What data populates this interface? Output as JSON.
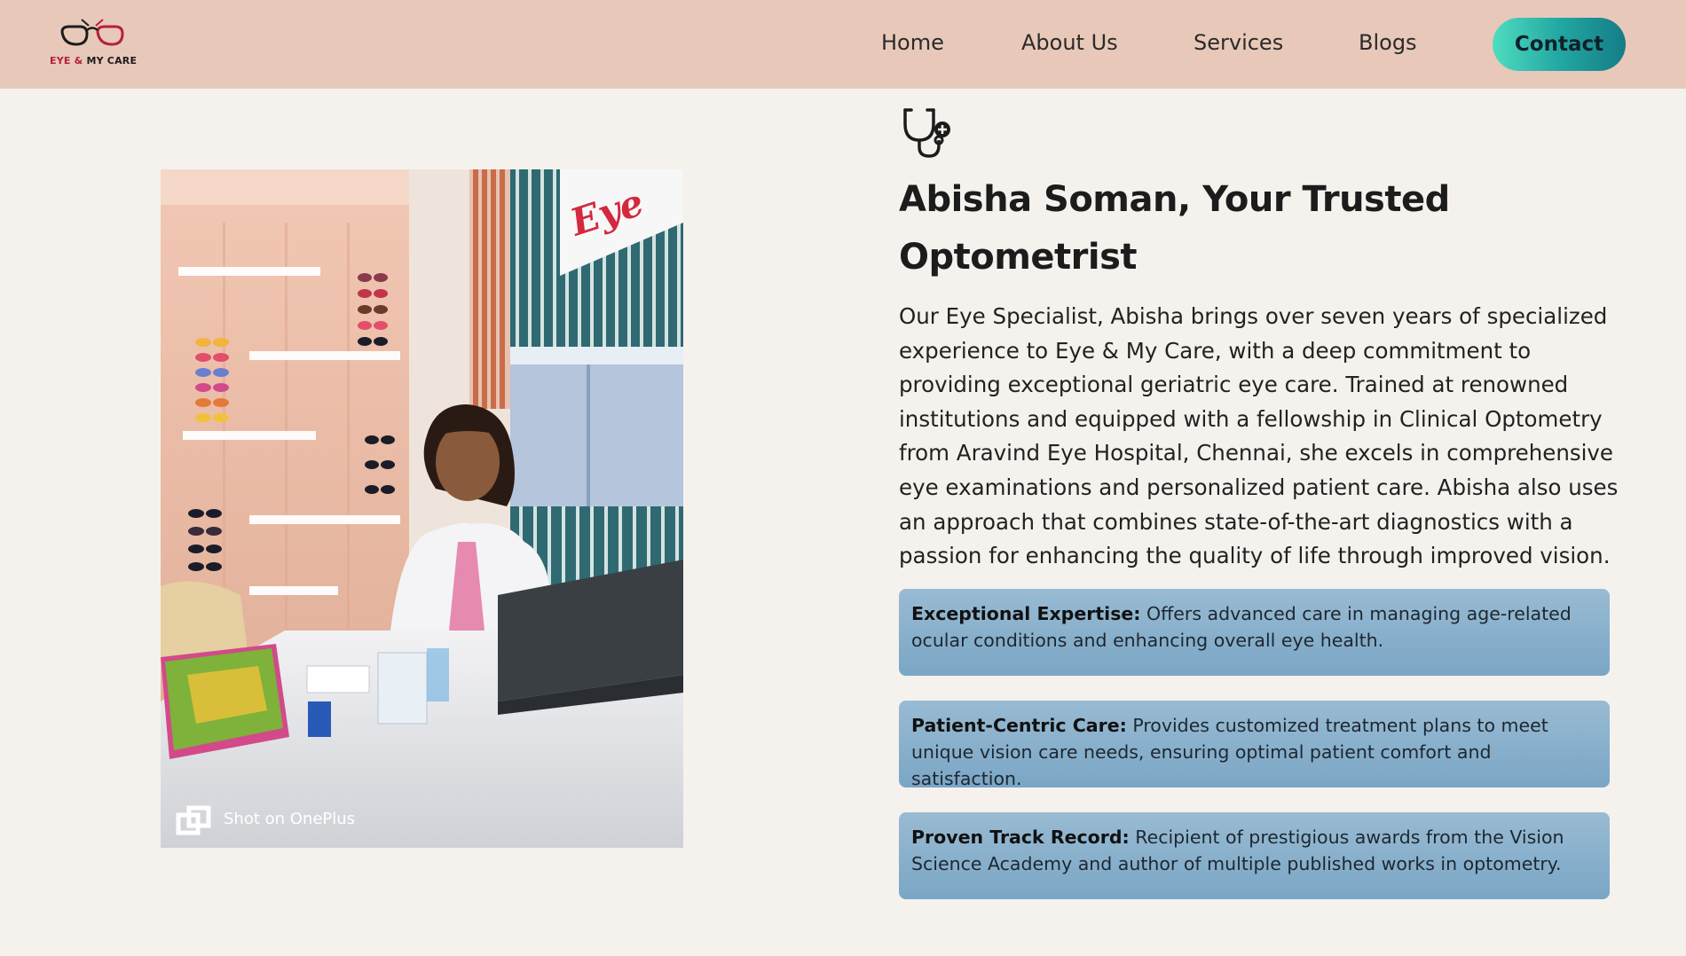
{
  "brand": {
    "logo_text_part1": "EYE &",
    "logo_text_part2": "MY CARE"
  },
  "nav": {
    "home": "Home",
    "about": "About Us",
    "services": "Services",
    "blogs": "Blogs",
    "contact": "Contact"
  },
  "photo": {
    "sign_text": "Eye",
    "watermark": "Shot on OnePlus"
  },
  "profile": {
    "icon": "stethoscope-icon",
    "title": "Abisha Soman, Your Trusted Optometrist",
    "description": "Our Eye Specialist, Abisha brings over seven years of specialized experience to Eye & My Care, with a deep commitment to providing exceptional geriatric eye care. Trained at renowned institutions and equipped with a fellowship in Clinical Optometry from Aravind Eye Hospital, Chennai, she excels in comprehensive eye examinations and personalized patient care. Abisha also uses an approach that combines state-of-the-art diagnostics with a passion for enhancing the quality of life through improved vision."
  },
  "highlights": [
    {
      "label": "Exceptional Expertise:",
      "text": "Offers advanced care in managing age-related ocular conditions and enhancing overall eye health."
    },
    {
      "label": "Patient-Centric Care:",
      "text": "Provides customized treatment plans to meet unique vision care needs, ensuring optimal patient comfort and satisfaction."
    },
    {
      "label": "Proven Track Record:",
      "text": "Recipient of prestigious awards from the Vision Science Academy and author of multiple published works in optometry."
    }
  ],
  "colors": {
    "header_bg": "#e8c9b9",
    "page_bg": "#f5f2ee",
    "contact_gradient_start": "#4fdcc0",
    "contact_gradient_end": "#157c86",
    "card_bg": "#8fb4cf",
    "brand_red": "#b5213a"
  }
}
